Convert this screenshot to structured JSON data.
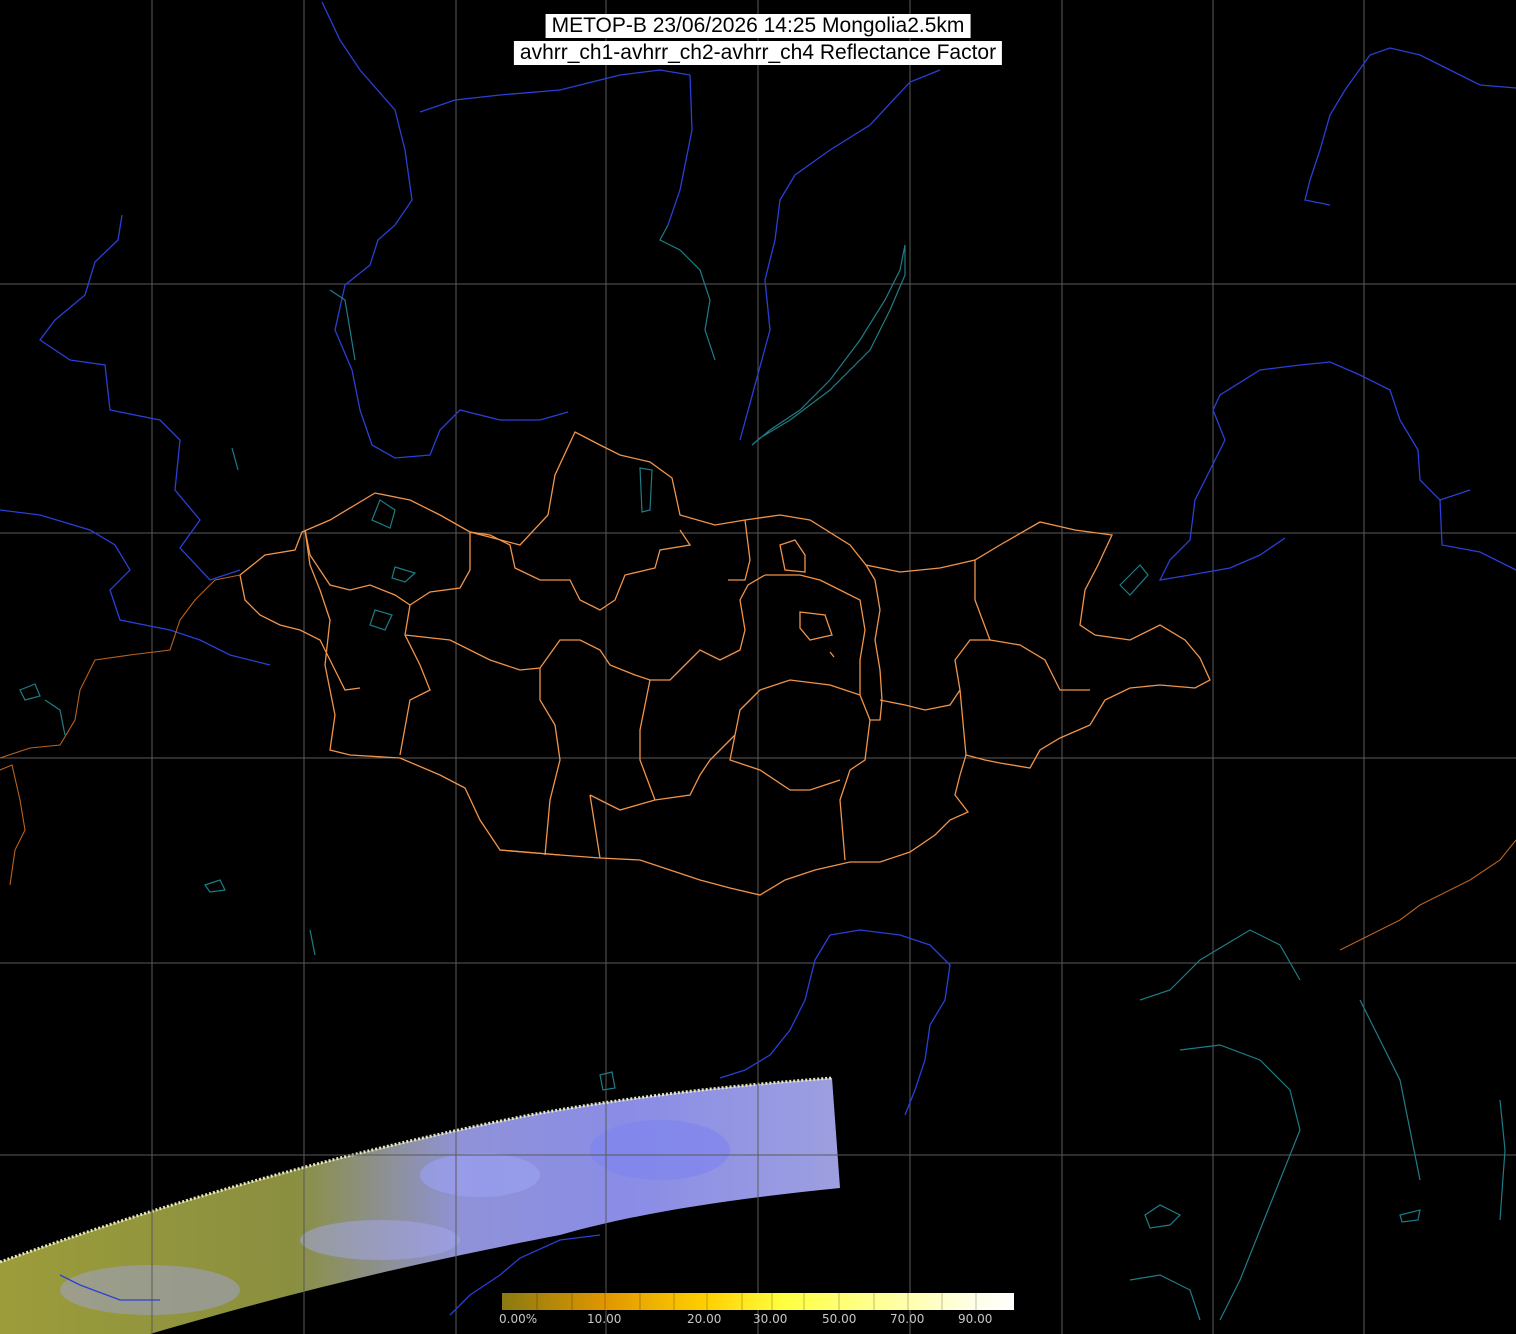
{
  "title": {
    "line1": "METOP-B 23/06/2026 14:25 Mongolia2.5km",
    "line2": "avhrr_ch1-avhrr_ch2-avhrr_ch4 Reflectance Factor"
  },
  "colors": {
    "background": "#000000",
    "grid": "#5a5a5a",
    "country_border": "#2a3fd6",
    "province_border": "#f0944a",
    "water": "#1f7c86",
    "swath_low": "#8a8a1e",
    "swath_high": "#8e8ff0"
  },
  "colorbar": {
    "labels": [
      "0.00%",
      "10.00",
      "20.00",
      "30.00",
      "50.00",
      "70.00",
      "90.00"
    ],
    "stops": [
      "#8a7a10",
      "#c8900a",
      "#f0a800",
      "#ffd800",
      "#ffff40",
      "#ffff90",
      "#ffffd0",
      "#ffffff"
    ]
  },
  "icons": {
    "colorbar": "color-scale-bar"
  }
}
